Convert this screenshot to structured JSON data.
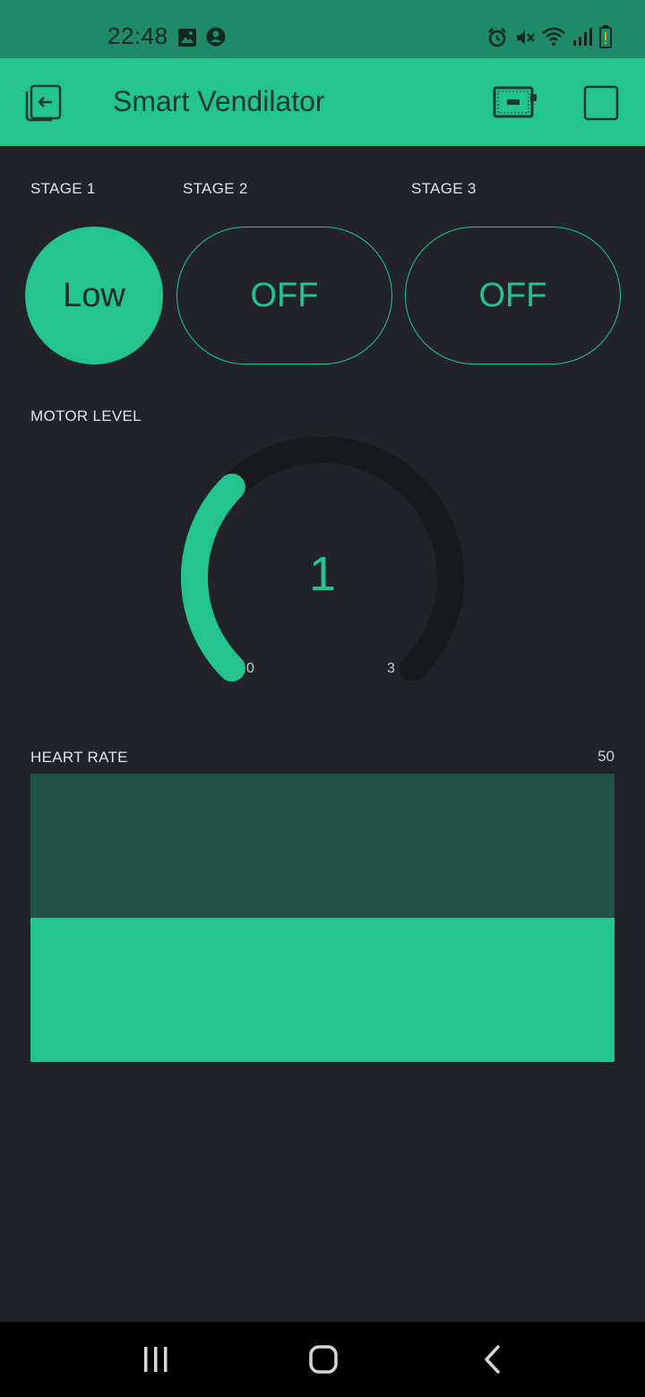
{
  "status_bar": {
    "time": "22:48"
  },
  "app_bar": {
    "title": "Smart Vendilator"
  },
  "stages": [
    {
      "label": "STAGE 1",
      "value": "Low",
      "active": true
    },
    {
      "label": "STAGE 2",
      "value": "OFF",
      "active": false
    },
    {
      "label": "STAGE 3",
      "value": "OFF",
      "active": false
    }
  ],
  "motor": {
    "label": "MOTOR LEVEL",
    "value": "1",
    "min": "0",
    "max": "3",
    "level": 1,
    "range": [
      0,
      3
    ]
  },
  "heart_rate": {
    "label": "HEART RATE",
    "max": "50",
    "fill_fraction": 0.5
  },
  "colors": {
    "accent": "#23c48e",
    "background": "#212328",
    "header": "#23c48e",
    "status_bar": "#1f8a67"
  }
}
